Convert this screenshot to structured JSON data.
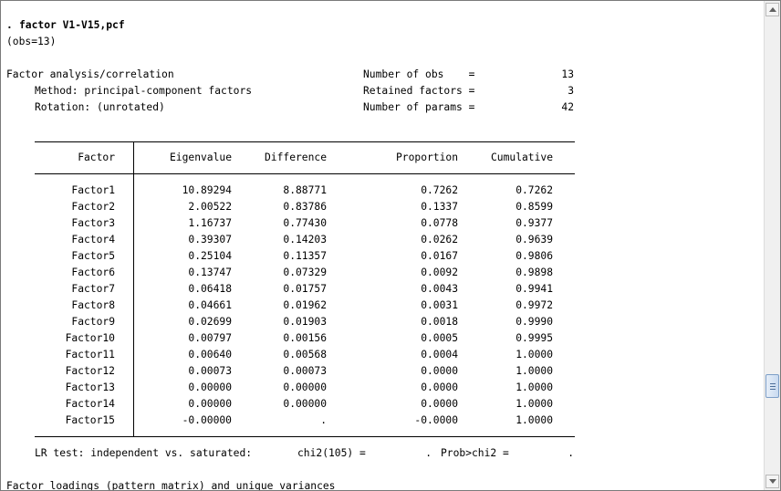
{
  "command": {
    "prompt": ".",
    "text": "factor V1-V15,pcf"
  },
  "obs_note": "(obs=13)",
  "header": {
    "title": "Factor analysis/correlation",
    "method_label": "Method: principal-component factors",
    "rotation_label": "Rotation: (unrotated)",
    "stats": [
      {
        "label": "Number of obs    =",
        "value": "13"
      },
      {
        "label": "Retained factors =",
        "value": "3"
      },
      {
        "label": "Number of params =",
        "value": "42"
      }
    ]
  },
  "table": {
    "columns": [
      "Factor",
      "Eigenvalue",
      "Difference",
      "Proportion",
      "Cumulative"
    ],
    "rows": [
      [
        "Factor1",
        "10.89294",
        "8.88771",
        "0.7262",
        "0.7262"
      ],
      [
        "Factor2",
        "2.00522",
        "0.83786",
        "0.1337",
        "0.8599"
      ],
      [
        "Factor3",
        "1.16737",
        "0.77430",
        "0.0778",
        "0.9377"
      ],
      [
        "Factor4",
        "0.39307",
        "0.14203",
        "0.0262",
        "0.9639"
      ],
      [
        "Factor5",
        "0.25104",
        "0.11357",
        "0.0167",
        "0.9806"
      ],
      [
        "Factor6",
        "0.13747",
        "0.07329",
        "0.0092",
        "0.9898"
      ],
      [
        "Factor7",
        "0.06418",
        "0.01757",
        "0.0043",
        "0.9941"
      ],
      [
        "Factor8",
        "0.04661",
        "0.01962",
        "0.0031",
        "0.9972"
      ],
      [
        "Factor9",
        "0.02699",
        "0.01903",
        "0.0018",
        "0.9990"
      ],
      [
        "Factor10",
        "0.00797",
        "0.00156",
        "0.0005",
        "0.9995"
      ],
      [
        "Factor11",
        "0.00640",
        "0.00568",
        "0.0004",
        "1.0000"
      ],
      [
        "Factor12",
        "0.00073",
        "0.00073",
        "0.0000",
        "1.0000"
      ],
      [
        "Factor13",
        "0.00000",
        "0.00000",
        "0.0000",
        "1.0000"
      ],
      [
        "Factor14",
        "0.00000",
        "0.00000",
        "0.0000",
        "1.0000"
      ],
      [
        "Factor15",
        "-0.00000",
        ".",
        "-0.0000",
        "1.0000"
      ]
    ]
  },
  "lr_test": {
    "label": "LR test: independent vs. saturated:",
    "chi2_label": "chi2(105) =",
    "chi2_value": ".",
    "prob_label": "Prob>chi2 =",
    "prob_value": "."
  },
  "next_section": "Factor loadings (pattern matrix) and unique variances",
  "scrollbar": {
    "up_icon": "arrow-up-icon",
    "down_icon": "arrow-down-icon",
    "position_fraction": 0.79
  }
}
